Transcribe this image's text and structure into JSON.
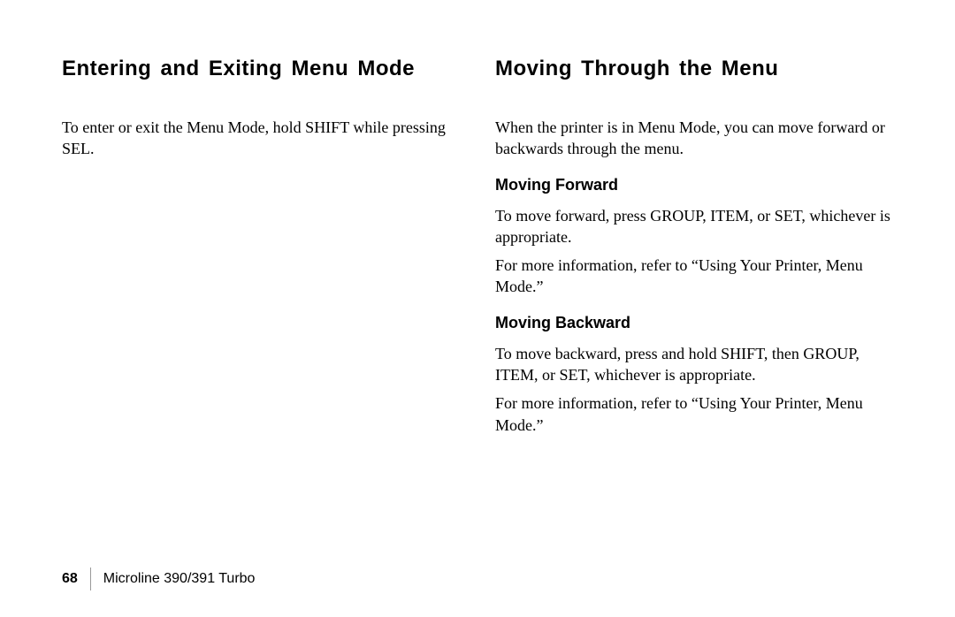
{
  "left": {
    "heading": "Entering and Exiting Menu Mode",
    "body1": "To enter or exit the Menu Mode, hold SHIFT while pressing SEL."
  },
  "right": {
    "heading": "Moving Through the Menu",
    "intro": "When the printer is in Menu Mode, you can move forward or backwards through the menu.",
    "forward": {
      "heading": "Moving Forward",
      "p1": "To move forward, press GROUP, ITEM, or SET, whichever is appropriate.",
      "p2": "For more information, refer to “Using Your Printer, Menu Mode.”"
    },
    "backward": {
      "heading": "Moving Backward",
      "p1": "To move backward, press and hold SHIFT, then GROUP, ITEM, or SET, whichever is appropriate.",
      "p2": "For more information, refer to “Using Your Printer, Menu Mode.”"
    }
  },
  "footer": {
    "page": "68",
    "product": "Microline 390/391 Turbo"
  }
}
